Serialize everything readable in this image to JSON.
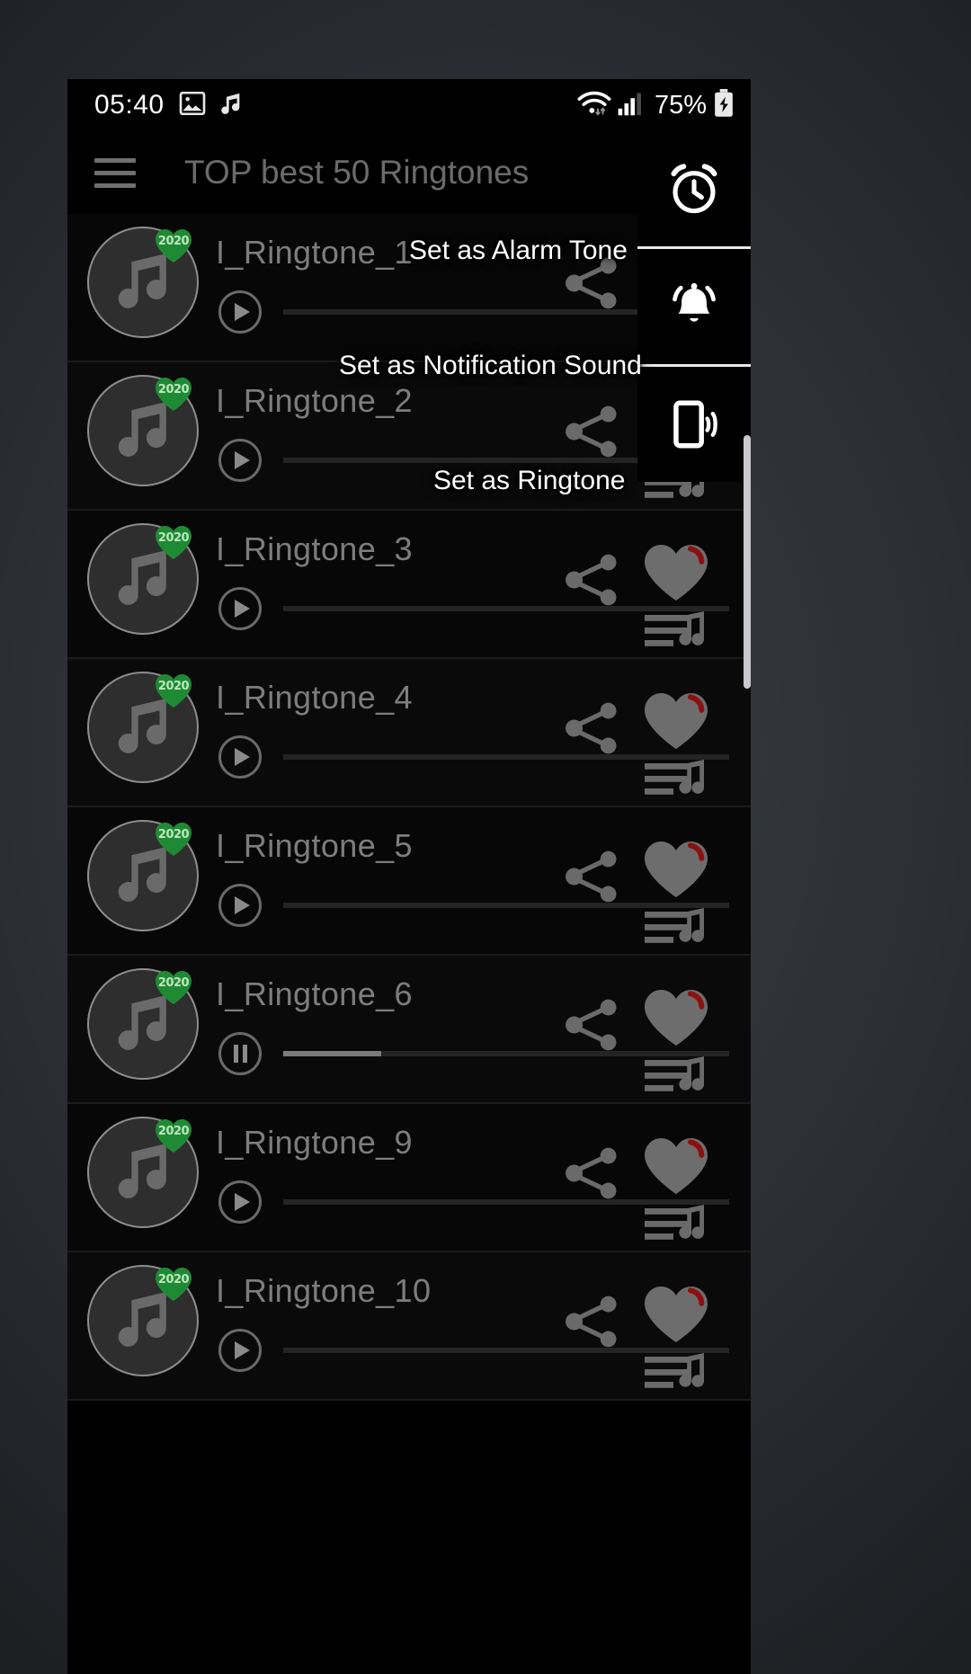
{
  "status_bar": {
    "time": "05:40",
    "battery_percent": "75%",
    "icons": [
      "image-icon",
      "music-note-icon",
      "wifi-icon",
      "cellular-signal-icon",
      "battery-charging-icon"
    ]
  },
  "app_bar": {
    "menu_icon": "hamburger-menu-icon",
    "title": "TOP best 50 Ringtones"
  },
  "action_panel": {
    "items": [
      {
        "icon": "alarm-clock-icon",
        "label": "Set as Alarm Tone"
      },
      {
        "icon": "notification-bell-icon",
        "label": "Set as Notification Sound"
      },
      {
        "icon": "phone-ringtone-icon",
        "label": "Set as Ringtone"
      }
    ]
  },
  "list": {
    "badge_year": "2020",
    "rows": [
      {
        "title": "I_Ringtone_1",
        "state": "paused",
        "progress": 0
      },
      {
        "title": "I_Ringtone_2",
        "state": "paused",
        "progress": 0
      },
      {
        "title": "I_Ringtone_3",
        "state": "paused",
        "progress": 0
      },
      {
        "title": "I_Ringtone_4",
        "state": "paused",
        "progress": 0
      },
      {
        "title": "I_Ringtone_5",
        "state": "paused",
        "progress": 0
      },
      {
        "title": "I_Ringtone_6",
        "state": "playing",
        "progress": 22
      },
      {
        "title": "I_Ringtone_9",
        "state": "paused",
        "progress": 0
      },
      {
        "title": "I_Ringtone_10",
        "state": "paused",
        "progress": 0
      }
    ]
  },
  "colors": {
    "badge_green": "#1f8a34",
    "heart_gray": "#6d6d6d",
    "heart_accent": "#8c1010",
    "title_gray": "#7d7d7d"
  }
}
